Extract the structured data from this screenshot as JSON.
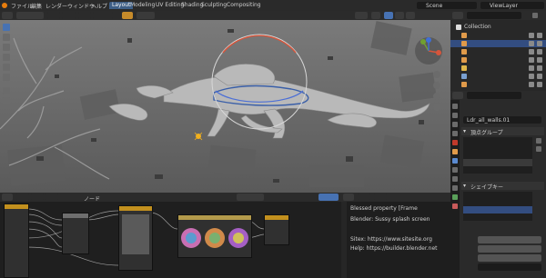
{
  "topbar": {
    "menus": [
      "ファイル",
      "編集",
      "レンダー",
      "ウィンドウ",
      "ヘルプ"
    ],
    "workspace_tabs": [
      "Layout",
      "Modeling",
      "UV Editing",
      "Shading",
      "Sculpting",
      "Compositing"
    ],
    "active_tab_index": 0,
    "scene_field": "Scene",
    "viewlayer_field": "ViewLayer"
  },
  "outliner": {
    "items": [
      "Collection",
      "",
      "",
      "",
      "",
      "",
      "",
      "",
      ""
    ]
  },
  "properties": {
    "object_field": "Ldr_all_walls.01",
    "section_vertex_groups": "頂点グループ",
    "section_shape_keys": "シェイプキー"
  },
  "node_editor": {
    "tab_label": "ノード"
  },
  "text_editor": {
    "lines": [
      "Blessed property [Frame",
      "Blender: Sussy splash screen",
      "",
      "Sitex: https://www.sitesite.org",
      "Help: https://builder.blender.net"
    ]
  },
  "colors": {
    "accent": "#4772b3",
    "active_header": "#3d5e86",
    "selected_row": "#334d80"
  }
}
